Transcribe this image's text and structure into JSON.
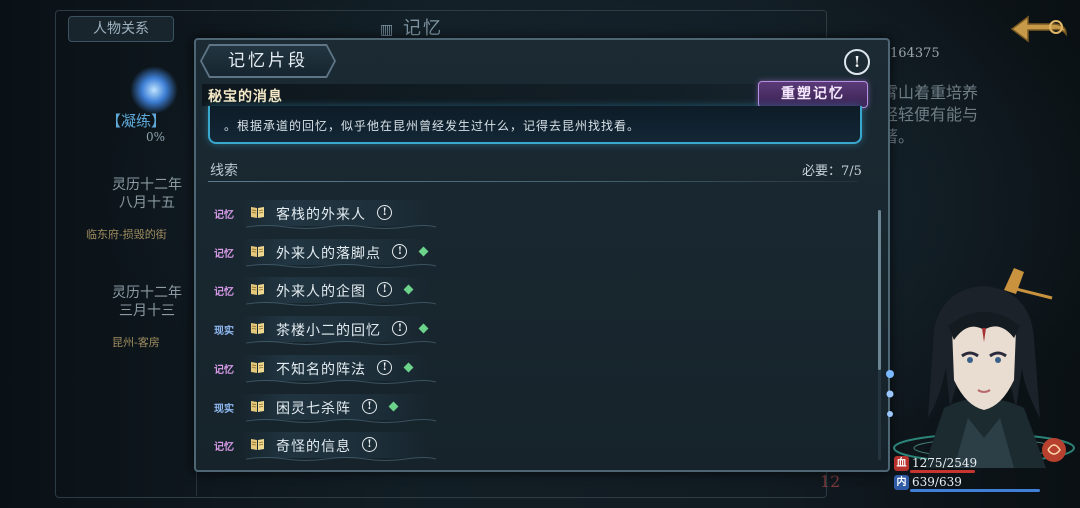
{
  "background": {
    "tab_label": "人物关系",
    "title": "记忆",
    "skill_label": "【凝练】",
    "skill_percent": "0%",
    "entries": [
      {
        "date_line1": "灵历十二年",
        "date_line2": "八月十五",
        "place": "临东府-损毁的街"
      },
      {
        "date_line1": "灵历十二年",
        "date_line2": "三月十三",
        "place": "昆州-客房"
      }
    ],
    "right_number": "164375",
    "right_text": "霄山着重培养\n轻轻便有能与\n著。",
    "bottom_number": "12"
  },
  "panel": {
    "title": "记忆片段",
    "secret_title": "秘宝的消息",
    "rebuild_button": "重塑记忆",
    "text_partial": "",
    "text_line": "。根据承道的回忆，似乎他在昆州曾经发生过什么，记得去昆州找找看。",
    "clue_label": "线索",
    "need_label": "必要：7/5",
    "scroll_progress": 0.64,
    "clues": [
      {
        "tag": "记忆",
        "kind": "mem",
        "name": "客栈的外来人",
        "gem": false
      },
      {
        "tag": "记忆",
        "kind": "mem",
        "name": "外来人的落脚点",
        "gem": true
      },
      {
        "tag": "记忆",
        "kind": "mem",
        "name": "外来人的企图",
        "gem": true
      },
      {
        "tag": "现实",
        "kind": "real",
        "name": "茶楼小二的回忆",
        "gem": true
      },
      {
        "tag": "记忆",
        "kind": "mem",
        "name": "不知名的阵法",
        "gem": true
      },
      {
        "tag": "现实",
        "kind": "real",
        "name": "困灵七杀阵",
        "gem": true
      },
      {
        "tag": "记忆",
        "kind": "mem",
        "name": "奇怪的信息",
        "gem": false
      }
    ]
  },
  "character": {
    "hp_icon": "血",
    "hp": "1275/2549",
    "hp_fraction": 0.5,
    "mp_icon": "内",
    "mp": "639/639",
    "mp_fraction": 1.0,
    "hp_color": "#c8342f",
    "mp_color": "#3f7fd8"
  },
  "icons": {
    "info": "!",
    "book": "book-icon",
    "gem": "green-gem-icon",
    "back": "back-arrow-icon"
  }
}
